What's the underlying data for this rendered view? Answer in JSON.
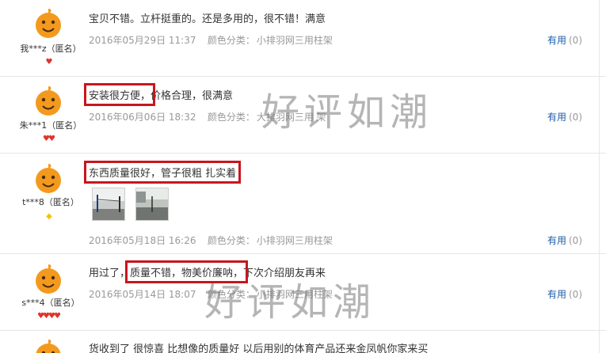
{
  "useful_label": "有用",
  "color_label": "颜色分类：",
  "watermark": "好评如潮",
  "reviews": [
    {
      "user": "我***z（匿名）",
      "content_pre": "宝贝不错。立杆挺重的。还是多用的，很不错！满意",
      "content_hl": "",
      "content_post": "",
      "date": "2016年05月29日 11:37",
      "color": "小排羽网三用柱架",
      "count": "(0)"
    },
    {
      "user": "朱***1（匿名）",
      "content_pre": "",
      "content_hl": "安装很方便，",
      "content_post": "价格合理，很满意",
      "date": "2016年06月06日 18:32",
      "color": "大排羽网三用 架",
      "count": "(0)"
    },
    {
      "user": "t***8（匿名）",
      "content_pre": "",
      "content_hl": "东西质量很好，管子很粗 扎实着",
      "content_post": "",
      "date": "2016年05月18日 16:26",
      "color": "小排羽网三用柱架",
      "count": "(0)"
    },
    {
      "user": "s***4（匿名）",
      "content_pre": "用过了，",
      "content_hl": "质量不错，物美价廉呐，",
      "content_post": "下次介绍朋友再来",
      "date": "2016年05月14日 18:07",
      "color": "小排羽网三用柱架",
      "count": "(0)"
    },
    {
      "content_pre": "货收到了 很惊喜 比想像的质量好 以后用别的体育产品还来金凤帆你家来买"
    }
  ],
  "colors": {
    "link": "#1a5ca9",
    "highlight_box": "#c8161d",
    "heart": "#e0322c",
    "diamond": "#f5c400",
    "avatar": "#f39a1e"
  }
}
